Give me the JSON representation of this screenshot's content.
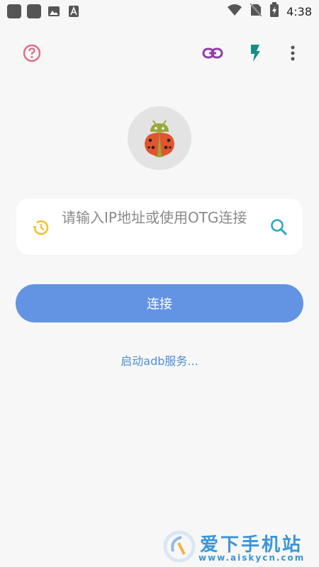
{
  "status_bar": {
    "time": "4:38",
    "icons": [
      "app-icon",
      "app-icon",
      "image-icon",
      "a-icon",
      "wifi-icon",
      "no-sim-icon",
      "battery-charging-icon"
    ]
  },
  "toolbar": {
    "icons": [
      "help-icon",
      "link-icon",
      "flash-icon",
      "more-vert-icon"
    ],
    "colors": {
      "help": "#e06a8a",
      "link": "#8e3fa8",
      "flash": "#138f87",
      "more": "#555555"
    }
  },
  "main": {
    "logo_icon": "ladybug-android-logo",
    "input": {
      "placeholder": "请输入IP地址或使用OTG连接",
      "left_icon": "history-icon",
      "right_icon": "search-icon"
    },
    "connect_button": "连接",
    "start_adb_link": "启动adb服务..."
  },
  "watermark": {
    "title": "爱下手机站",
    "url": "www.aiskycn.com"
  },
  "colors": {
    "accent": "#6394e4",
    "link": "#4d8fd6",
    "history": "#f1c232"
  }
}
